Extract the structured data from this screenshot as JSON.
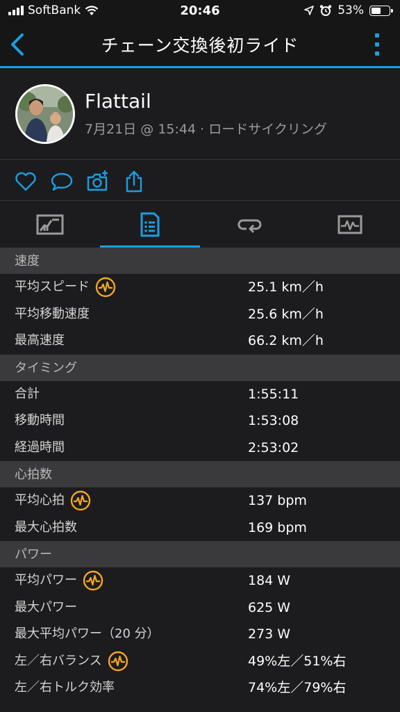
{
  "status": {
    "carrier": "SoftBank",
    "time": "20:46",
    "battery_percent": "53%",
    "battery_level": 0.53
  },
  "nav": {
    "title": "チェーン交換後初ライド",
    "back_icon": "chevron-left-icon",
    "more_icon": "more-vertical-icon"
  },
  "profile": {
    "name": "Flattail",
    "meta": "7月21日 @ 15:44 · ロードサイクリング"
  },
  "actions": [
    "heart-icon",
    "comment-icon",
    "camera-add-icon",
    "share-icon"
  ],
  "tabs": [
    {
      "icon": "map-overview-icon",
      "active": false
    },
    {
      "icon": "stats-list-icon",
      "active": true
    },
    {
      "icon": "laps-icon",
      "active": false
    },
    {
      "icon": "charts-icon",
      "active": false
    }
  ],
  "colors": {
    "accent": "#1a9fe0",
    "badge": "#f5a623",
    "section_bg": "#3a3a3c",
    "background": "#1c1c1e"
  },
  "sections": [
    {
      "title": "速度",
      "rows": [
        {
          "label": "平均スピード",
          "value": "25.1 km／h",
          "badge": true
        },
        {
          "label": "平均移動速度",
          "value": "25.6 km／h",
          "badge": false
        },
        {
          "label": "最高速度",
          "value": "66.2 km／h",
          "badge": false
        }
      ]
    },
    {
      "title": "タイミング",
      "rows": [
        {
          "label": "合計",
          "value": "1:55:11",
          "badge": false
        },
        {
          "label": "移動時間",
          "value": "1:53:08",
          "badge": false
        },
        {
          "label": "経過時間",
          "value": "2:53:02",
          "badge": false
        }
      ]
    },
    {
      "title": "心拍数",
      "rows": [
        {
          "label": "平均心拍",
          "value": "137 bpm",
          "badge": true
        },
        {
          "label": "最大心拍数",
          "value": "169 bpm",
          "badge": false
        }
      ]
    },
    {
      "title": "パワー",
      "rows": [
        {
          "label": "平均パワー",
          "value": "184 W",
          "badge": true
        },
        {
          "label": "最大パワー",
          "value": "625 W",
          "badge": false
        },
        {
          "label": "最大平均パワー（20 分）",
          "value": "273 W",
          "badge": false
        },
        {
          "label": "左／右バランス",
          "value": "49%左／51%右",
          "badge": true
        },
        {
          "label": "左／右トルク効率",
          "value": "74%左／79%右",
          "badge": false
        }
      ]
    }
  ]
}
